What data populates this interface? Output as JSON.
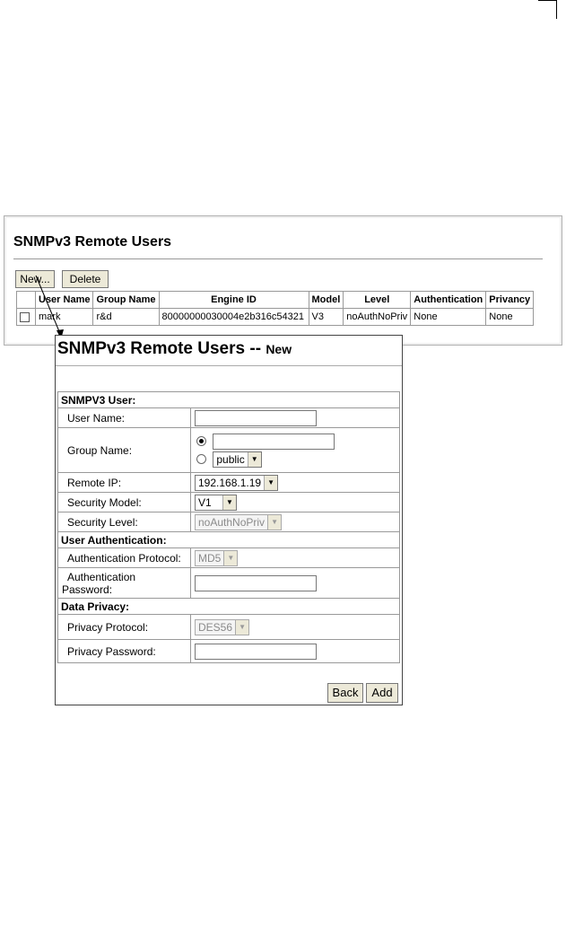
{
  "list_panel": {
    "title": "SNMPv3 Remote Users",
    "new_button": "New...",
    "delete_button": "Delete",
    "columns": [
      "User Name",
      "Group Name",
      "Engine ID",
      "Model",
      "Level",
      "Authentication",
      "Privancy"
    ],
    "rows": [
      {
        "user": "mark",
        "group": "r&d",
        "engine_id": "80000000030004e2b316c54321",
        "model": "V3",
        "level": "noAuthNoPriv",
        "auth": "None",
        "privacy": "None"
      }
    ]
  },
  "new_panel": {
    "title": "SNMPv3 Remote Users --",
    "subtitle": "New",
    "sections": {
      "user": "SNMPV3 User:",
      "auth": "User Authentication:",
      "privacy": "Data Privacy:"
    },
    "fields": {
      "user_name_label": "User Name:",
      "user_name_value": "",
      "group_name_label": "Group Name:",
      "group_custom_value": "",
      "group_select_value": "public",
      "remote_ip_label": "Remote IP:",
      "remote_ip_value": "192.168.1.19",
      "security_model_label": "Security Model:",
      "security_model_value": "V1",
      "security_level_label": "Security Level:",
      "security_level_value": "noAuthNoPriv",
      "auth_protocol_label": "Authentication Protocol:",
      "auth_protocol_value": "MD5",
      "auth_password_label_1": "Authentication",
      "auth_password_label_2": "Password:",
      "privacy_protocol_label": "Privacy Protocol:",
      "privacy_protocol_value": "DES56",
      "privacy_password_label": "Privacy Password:"
    },
    "back_button": "Back",
    "add_button": "Add"
  }
}
